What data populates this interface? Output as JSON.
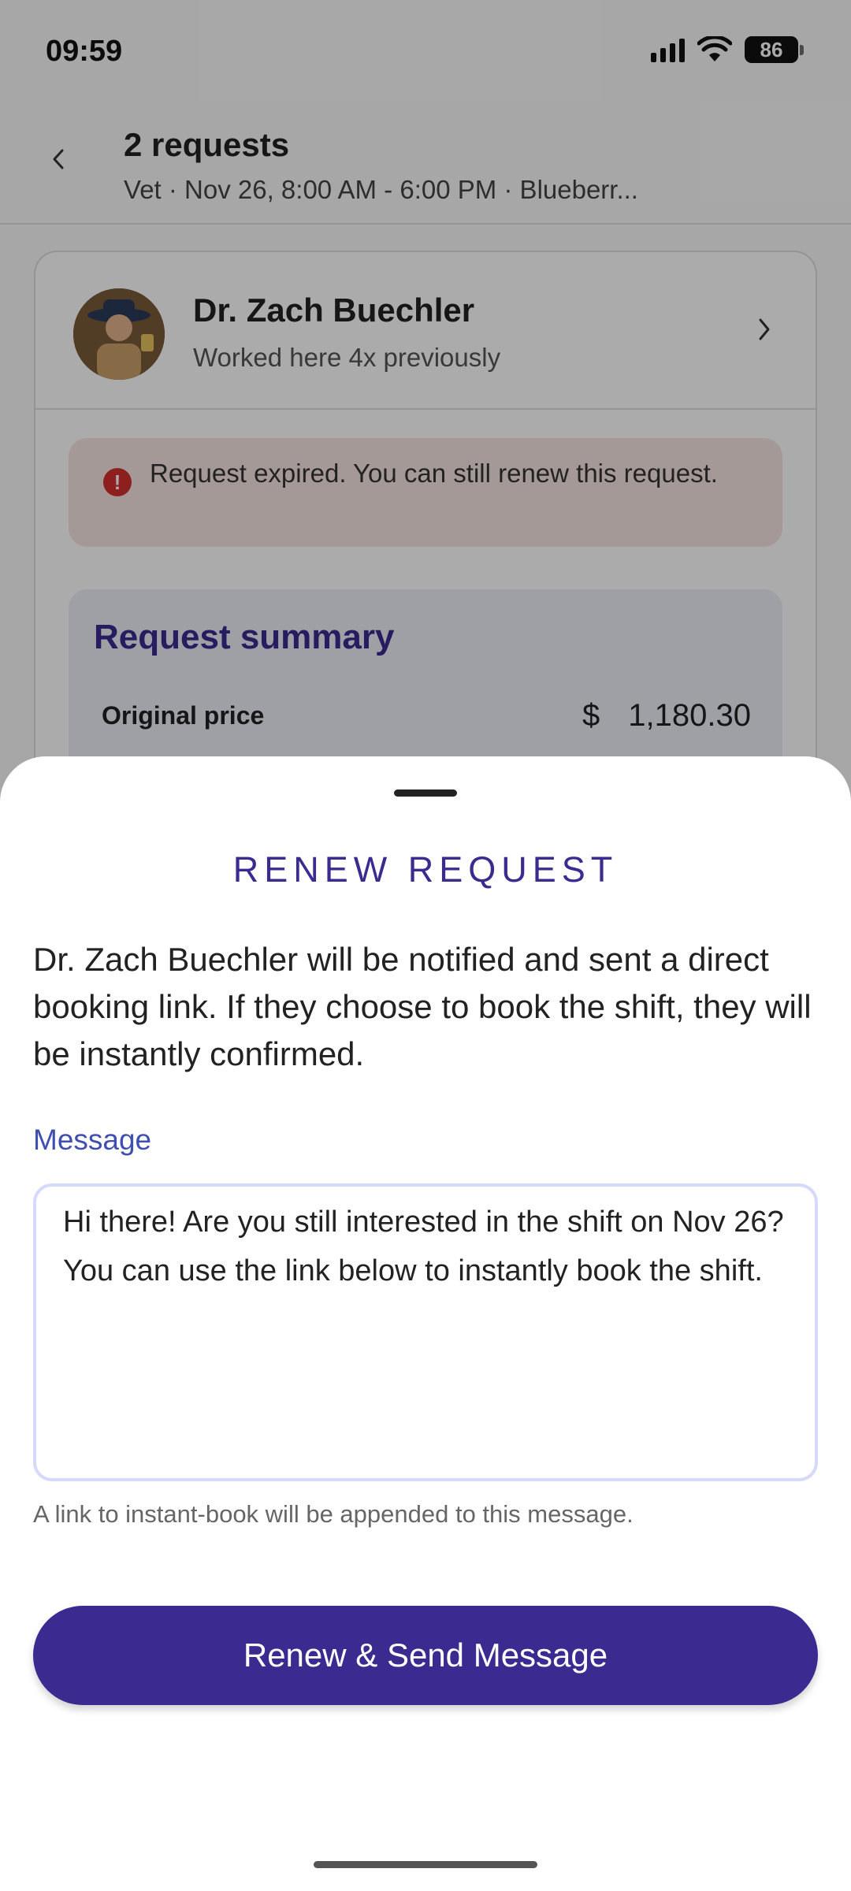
{
  "status_bar": {
    "time": "09:59",
    "battery": "86",
    "icons": [
      "signal-icon",
      "wifi-icon",
      "battery-icon"
    ]
  },
  "header": {
    "title": "2 requests",
    "subtitle": "Vet · Nov 26, 8:00 AM - 6:00 PM · Blueberr...",
    "back_icon": "chevron-left-icon"
  },
  "vet": {
    "name": "Dr. Zach Buechler",
    "history": "Worked here 4x previously"
  },
  "alert": {
    "text": "Request expired. You can still renew this request.",
    "color": "#d32f2f"
  },
  "summary": {
    "title": "Request summary",
    "original_price_label": "Original price",
    "currency": "$",
    "original_price_value": "1,180.30"
  },
  "sheet": {
    "title": "RENEW REQUEST",
    "description": "Dr. Zach Buechler will be notified and sent a direct booking link. If they choose to book the shift, they will be instantly confirmed.",
    "message_label": "Message",
    "message_value": "Hi there! Are you still interested in the shift on Nov 26? You can use the link below to instantly book the shift.",
    "helper_text": "A link to instant-book will be appended to this message.",
    "button_label": "Renew & Send Message"
  },
  "colors": {
    "brand": "#3b2a8f",
    "label_blue": "#3f4fb0",
    "alert_bg": "#f7e4e2"
  }
}
